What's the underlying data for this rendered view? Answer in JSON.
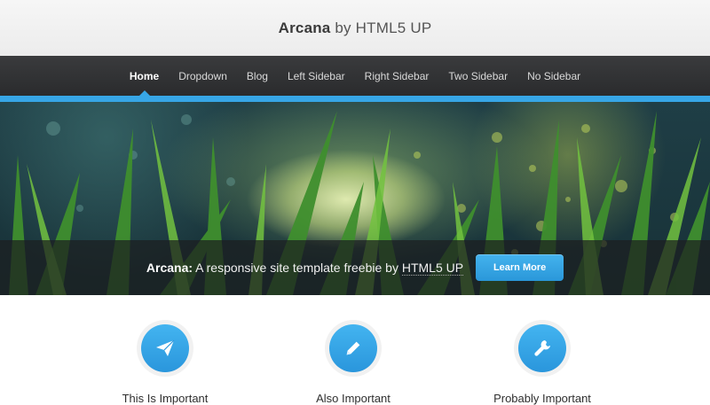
{
  "header": {
    "brand": "Arcana",
    "by": "by HTML5 UP"
  },
  "nav": {
    "items": [
      {
        "label": "Home",
        "active": true
      },
      {
        "label": "Dropdown"
      },
      {
        "label": "Blog"
      },
      {
        "label": "Left Sidebar"
      },
      {
        "label": "Right Sidebar"
      },
      {
        "label": "Two Sidebar"
      },
      {
        "label": "No Sidebar"
      }
    ]
  },
  "banner": {
    "lead": "Arcana:",
    "text": " A responsive site template freebie by ",
    "link": "HTML5 UP",
    "button": "Learn More"
  },
  "features": [
    {
      "title": "This Is Important",
      "icon": "paper-plane-icon"
    },
    {
      "title": "Also Important",
      "icon": "pencil-icon"
    },
    {
      "title": "Probably Important",
      "icon": "wrench-icon"
    }
  ],
  "colors": {
    "accent": "#37a6e6",
    "nav_bg": "#2f3032",
    "header_bg": "#f2f2f2"
  }
}
